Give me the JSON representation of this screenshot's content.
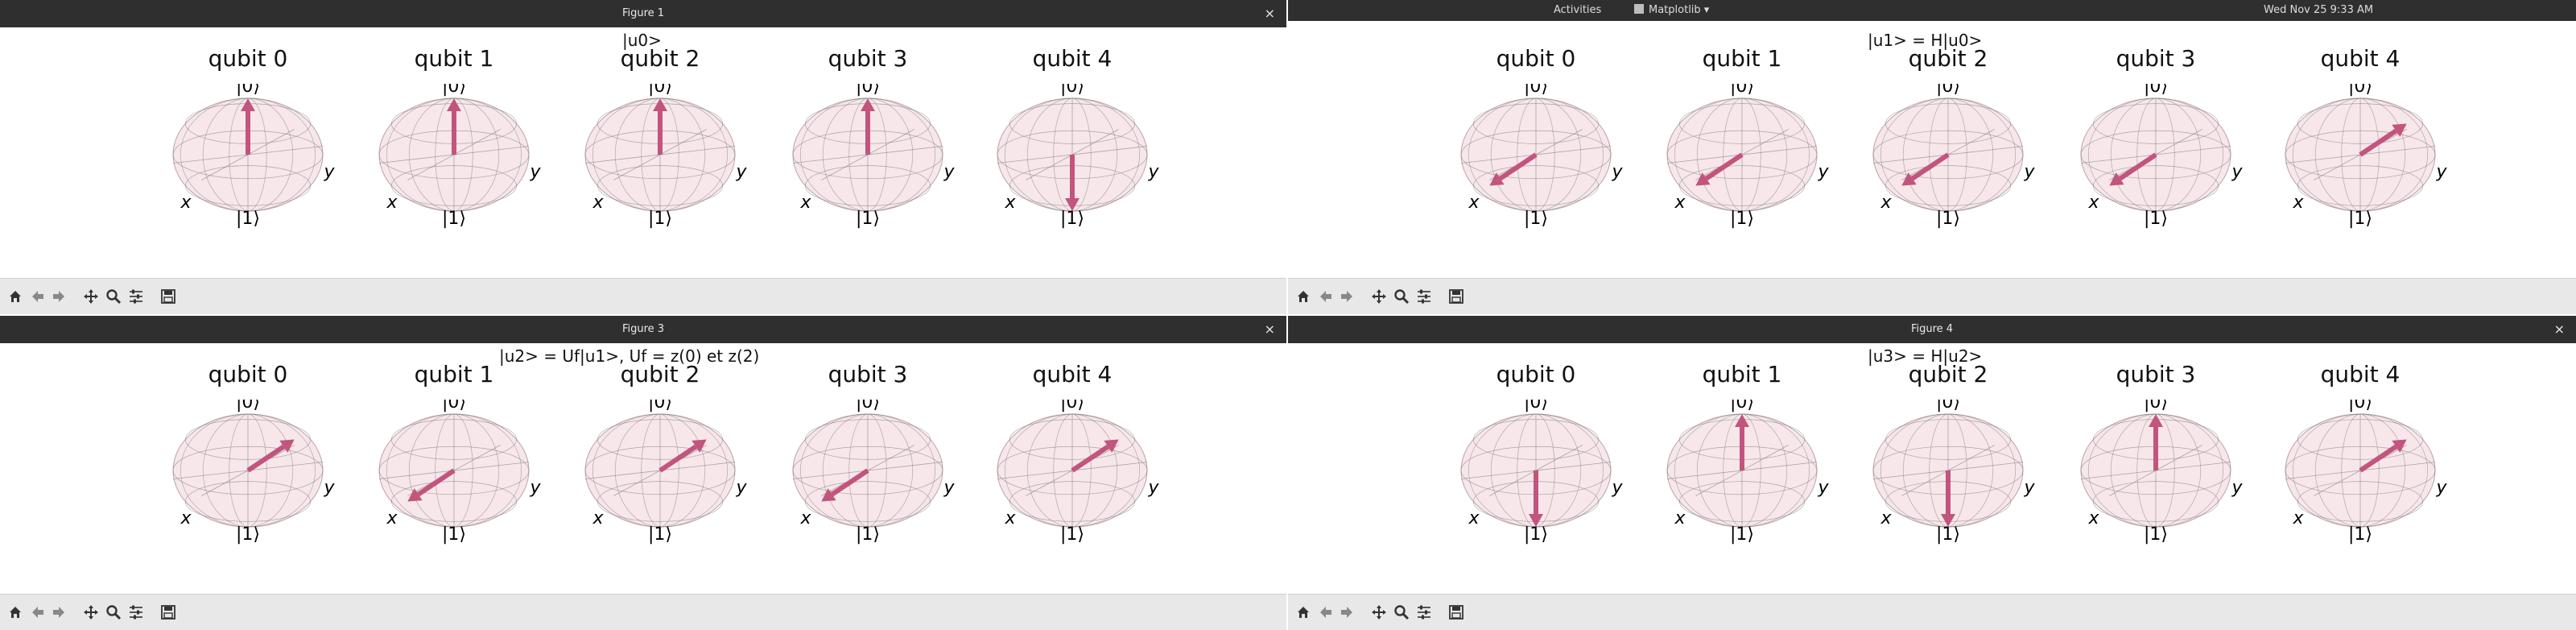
{
  "topbar": {
    "activities": "Activities",
    "app_menu": "Matplotlib",
    "clock": "Wed Nov 25   9:33 AM"
  },
  "windows": [
    {
      "title": "Figure 1",
      "figure_title": "|u0>",
      "qubits": [
        {
          "label": "qubit 0",
          "vector": [
            0,
            0,
            1
          ]
        },
        {
          "label": "qubit 1",
          "vector": [
            0,
            0,
            1
          ]
        },
        {
          "label": "qubit 2",
          "vector": [
            0,
            0,
            1
          ]
        },
        {
          "label": "qubit 3",
          "vector": [
            0,
            0,
            1
          ]
        },
        {
          "label": "qubit 4",
          "vector": [
            0,
            0,
            -1
          ]
        }
      ]
    },
    {
      "title": "",
      "figure_title": "|u1> = H|u0>",
      "qubits": [
        {
          "label": "qubit 0",
          "vector": [
            1,
            0,
            0
          ]
        },
        {
          "label": "qubit 1",
          "vector": [
            1,
            0,
            0
          ]
        },
        {
          "label": "qubit 2",
          "vector": [
            1,
            0,
            0
          ]
        },
        {
          "label": "qubit 3",
          "vector": [
            1,
            0,
            0
          ]
        },
        {
          "label": "qubit 4",
          "vector": [
            -1,
            0,
            0
          ]
        }
      ]
    },
    {
      "title": "Figure 3",
      "figure_title": "|u2> = Uf|u1>, Uf = z(0) et z(2)",
      "qubits": [
        {
          "label": "qubit 0",
          "vector": [
            -1,
            0,
            0
          ]
        },
        {
          "label": "qubit 1",
          "vector": [
            1,
            0,
            0
          ]
        },
        {
          "label": "qubit 2",
          "vector": [
            -1,
            0,
            0
          ]
        },
        {
          "label": "qubit 3",
          "vector": [
            1,
            0,
            0
          ]
        },
        {
          "label": "qubit 4",
          "vector": [
            -1,
            0,
            0
          ]
        }
      ]
    },
    {
      "title": "Figure 4",
      "figure_title": "|u3> = H|u2>",
      "qubits": [
        {
          "label": "qubit 0",
          "vector": [
            0,
            0,
            -1
          ]
        },
        {
          "label": "qubit 1",
          "vector": [
            0,
            0,
            1
          ]
        },
        {
          "label": "qubit 2",
          "vector": [
            0,
            0,
            -1
          ]
        },
        {
          "label": "qubit 3",
          "vector": [
            0,
            0,
            1
          ]
        },
        {
          "label": "qubit 4",
          "vector": [
            -1,
            0,
            0
          ]
        }
      ]
    }
  ],
  "bloch_labels": {
    "top": "|0⟩",
    "bottom": "|1⟩",
    "x": "x",
    "y": "y"
  },
  "colors": {
    "vector": "#c2547e",
    "sphere_fill": "#f6e4e8",
    "wire": "#777777",
    "titlebar": "#2f2f2f",
    "toolbar": "#e8e8e8"
  },
  "toolbar_icons": [
    "home-icon",
    "back-arrow-icon",
    "forward-arrow-icon",
    "pan-icon",
    "zoom-icon",
    "configure-subplots-icon",
    "save-icon"
  ]
}
